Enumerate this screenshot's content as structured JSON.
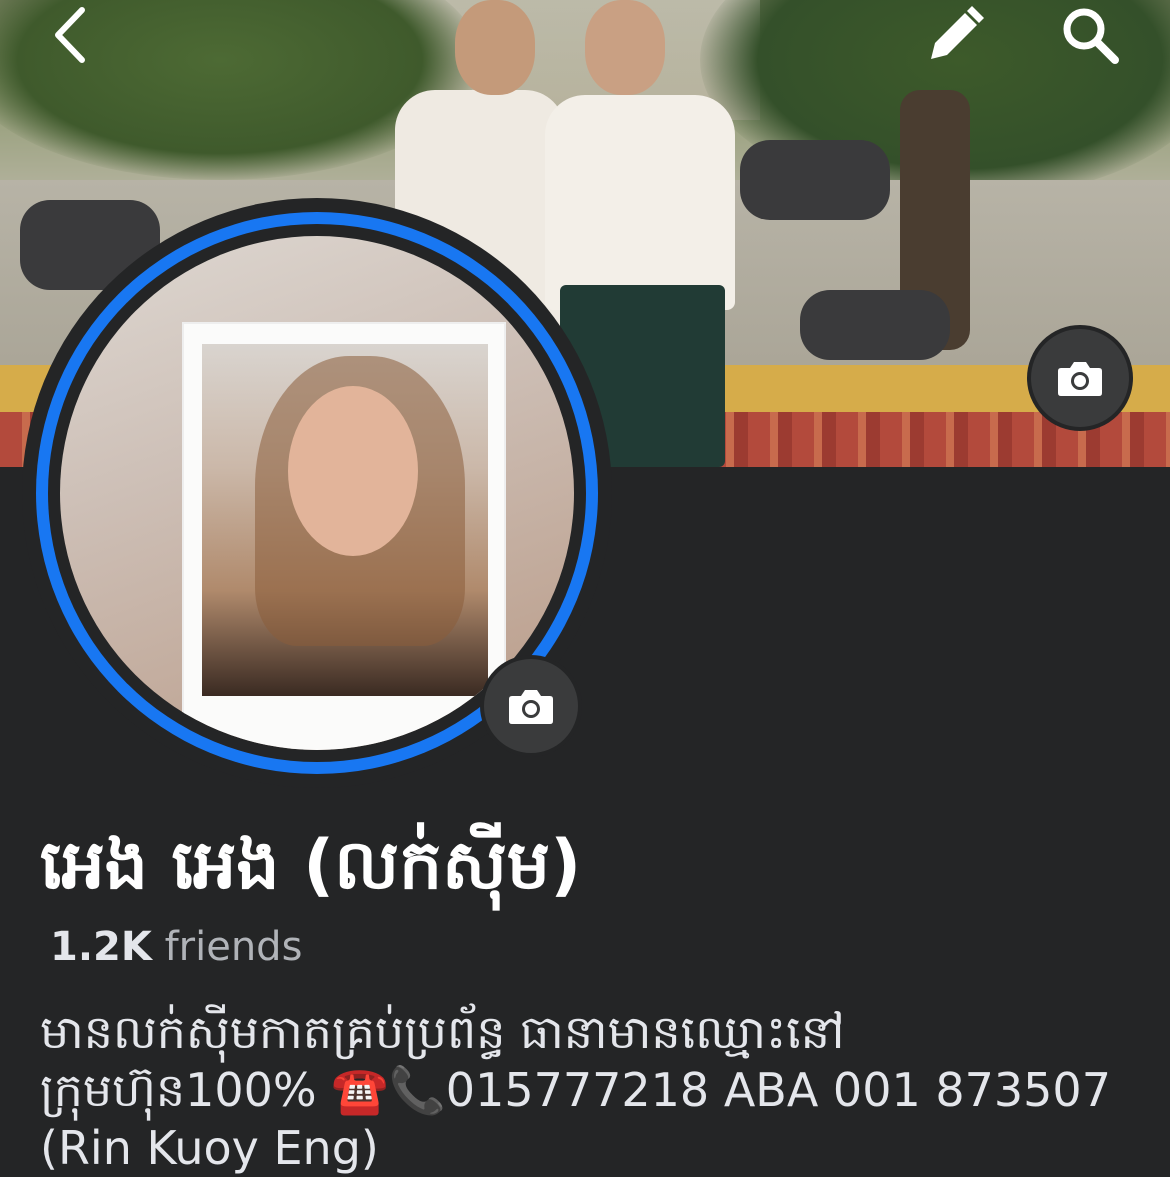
{
  "header": {
    "back_icon": "chevron-left-icon",
    "edit_icon": "pencil-icon",
    "search_icon": "search-icon"
  },
  "cover": {
    "camera_icon": "camera-icon"
  },
  "profile_picture": {
    "camera_icon": "camera-icon",
    "ring_color": "#1877f2"
  },
  "profile": {
    "name": "អេង អេង (លក់ស៊ីម)",
    "friends_count": "1.2K",
    "friends_label": "friends",
    "bio_line1": "មានលក់ស៊ីមកាតគ្រប់ប្រព័ន្ធ ធានាមានឈ្មោះនៅ",
    "bio_line2_text": "ក្រុមហ៊ុន100%",
    "bio_line2_icons": "☎️📞",
    "bio_line2_contact": "015777218 ABA 001 873507",
    "bio_line3": "(Rin Kuoy Eng)"
  },
  "colors": {
    "background": "#242526",
    "accent": "#1877f2",
    "button_bg": "#3a3b3c",
    "text_primary": "#e4e6eb",
    "text_secondary": "#b0b3b8"
  }
}
